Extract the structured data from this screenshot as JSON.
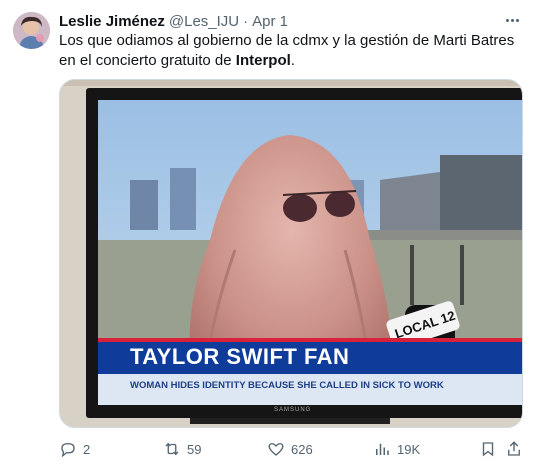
{
  "tweet": {
    "author": {
      "display_name": "Leslie Jiménez",
      "handle": "@Les_IJU",
      "separator": "·",
      "time": "Apr 1"
    },
    "text": {
      "line_plain": "Los que odiamos al gobierno de la cdmx y la gestión de Marti Batres en el concierto gratuito de ",
      "bold": "Interpol",
      "end": "."
    },
    "media": {
      "tv_brand": "SAMSUNG",
      "mic_flag": "LOCAL 12",
      "chyron_headline": "TAYLOR SWIFT FAN",
      "chyron_subline": "WOMAN HIDES IDENTITY BECAUSE SHE CALLED IN SICK TO WORK"
    },
    "actions": {
      "replies": "2",
      "reposts": "59",
      "likes": "626",
      "views": "19K"
    },
    "icons": [
      "more-icon",
      "reply-icon",
      "repost-icon",
      "like-icon",
      "views-icon",
      "bookmark-icon",
      "share-icon"
    ]
  }
}
